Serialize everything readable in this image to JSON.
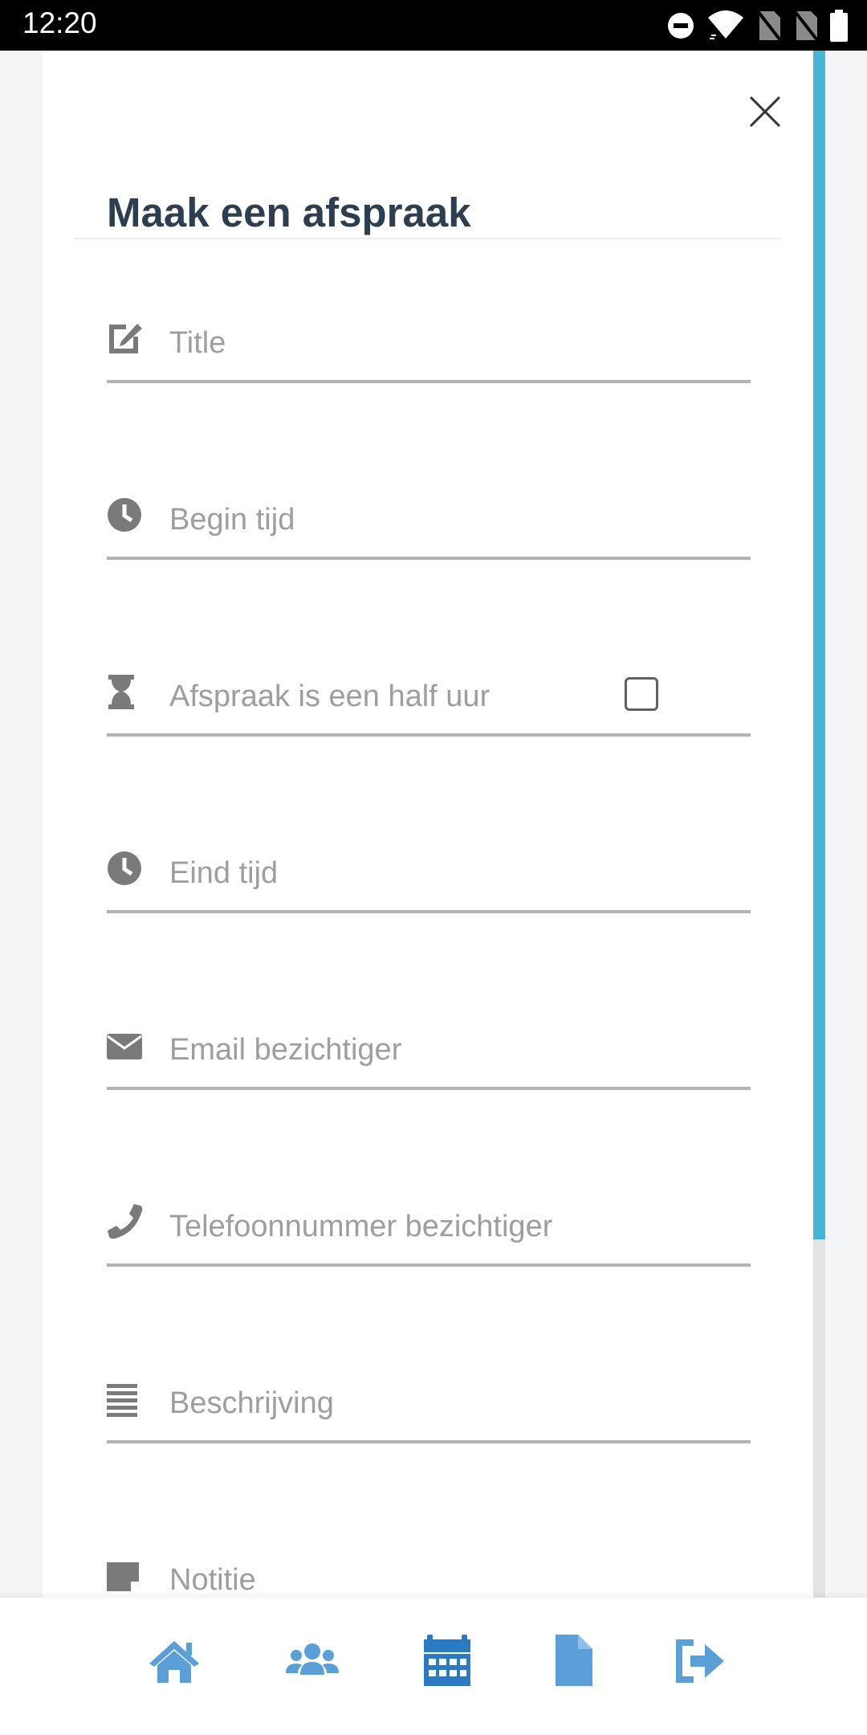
{
  "status_bar": {
    "time": "12:20",
    "icons": [
      "do-not-disturb-icon",
      "wifi-icon",
      "no-sim-icon",
      "no-sim-icon",
      "battery-icon"
    ]
  },
  "modal": {
    "title": "Maak een afspraak",
    "close_icon": "close-icon"
  },
  "form": {
    "fields": [
      {
        "name": "title",
        "icon": "edit-icon",
        "placeholder": "Title",
        "value": ""
      },
      {
        "name": "begin-time",
        "icon": "clock-icon",
        "placeholder": "Begin tijd",
        "value": ""
      },
      {
        "name": "half-hour",
        "icon": "hourglass-icon",
        "placeholder": "Afspraak is een half uur",
        "value": "",
        "checked": false
      },
      {
        "name": "end-time",
        "icon": "clock-icon",
        "placeholder": "Eind tijd",
        "value": ""
      },
      {
        "name": "viewer-email",
        "icon": "envelope-icon",
        "placeholder": "Email bezichtiger",
        "value": ""
      },
      {
        "name": "viewer-phone",
        "icon": "phone-icon",
        "placeholder": "Telefoonnummer bezichtiger",
        "value": ""
      },
      {
        "name": "description",
        "icon": "align-justify-icon",
        "placeholder": "Beschrijving",
        "value": ""
      },
      {
        "name": "note",
        "icon": "sticky-note-icon",
        "placeholder": "Notitie",
        "value": ""
      }
    ]
  },
  "bottom_nav": {
    "items": [
      {
        "name": "home",
        "icon": "home-icon",
        "active": false
      },
      {
        "name": "users",
        "icon": "users-icon",
        "active": false
      },
      {
        "name": "calendar",
        "icon": "calendar-icon",
        "active": true
      },
      {
        "name": "document",
        "icon": "file-icon",
        "active": false
      },
      {
        "name": "logout",
        "icon": "sign-out-icon",
        "active": false
      }
    ]
  },
  "colors": {
    "accent": "#45b6d6",
    "nav_icon": "#5a9fd8",
    "nav_icon_active": "#2a7ac4",
    "title": "#2d3e50",
    "field_icon": "#7a7a7a",
    "placeholder": "#9e9e9e",
    "underline": "#b3b3b3"
  }
}
